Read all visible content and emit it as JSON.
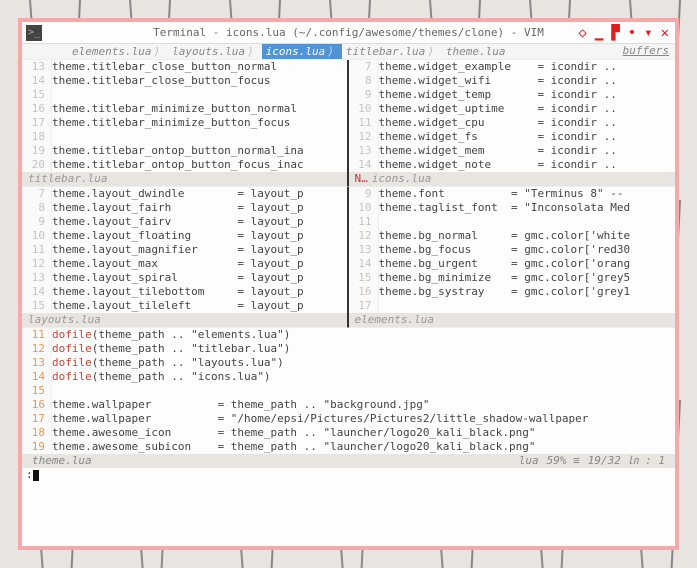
{
  "window": {
    "title": "Terminal - icons.lua (~/.config/awesome/themes/clone) - VIM"
  },
  "tabs": {
    "items": [
      {
        "label": "elements.lua",
        "active": false
      },
      {
        "label": "layouts.lua",
        "active": false
      },
      {
        "label": "icons.lua",
        "active": true
      },
      {
        "label": "titlebar.lua",
        "active": false
      },
      {
        "label": "theme.lua",
        "active": false
      }
    ],
    "right_label": "buffers"
  },
  "pane_top_left": {
    "status": "titlebar.lua",
    "lines": [
      {
        "n": 13,
        "text": "theme.titlebar_close_button_normal      "
      },
      {
        "n": 14,
        "text": "theme.titlebar_close_button_focus       "
      },
      {
        "n": 15,
        "text": ""
      },
      {
        "n": 16,
        "text": "theme.titlebar_minimize_button_normal   "
      },
      {
        "n": 17,
        "text": "theme.titlebar_minimize_button_focus    "
      },
      {
        "n": 18,
        "text": ""
      },
      {
        "n": 19,
        "text": "theme.titlebar_ontop_button_normal_ina  "
      },
      {
        "n": 20,
        "text": "theme.titlebar_ontop_button_focus_inac "
      }
    ]
  },
  "pane_top_right": {
    "status": "icons.lua",
    "status_mark": "N…",
    "lines": [
      {
        "n": 7,
        "text": "theme.widget_example    = icondir .."
      },
      {
        "n": 8,
        "text": "theme.widget_wifi       = icondir .."
      },
      {
        "n": 9,
        "text": "theme.widget_temp       = icondir .."
      },
      {
        "n": 10,
        "text": "theme.widget_uptime     = icondir .."
      },
      {
        "n": 11,
        "text": "theme.widget_cpu        = icondir .."
      },
      {
        "n": 12,
        "text": "theme.widget_fs         = icondir .."
      },
      {
        "n": 13,
        "text": "theme.widget_mem        = icondir .."
      },
      {
        "n": 14,
        "text": "theme.widget_note       = icondir .."
      }
    ]
  },
  "pane_mid_left": {
    "status": "layouts.lua",
    "lines": [
      {
        "n": 7,
        "text": "theme.layout_dwindle        = layout_p"
      },
      {
        "n": 8,
        "text": "theme.layout_fairh          = layout_p"
      },
      {
        "n": 9,
        "text": "theme.layout_fairv          = layout_p"
      },
      {
        "n": 10,
        "text": "theme.layout_floating       = layout_p"
      },
      {
        "n": 11,
        "text": "theme.layout_magnifier      = layout_p"
      },
      {
        "n": 12,
        "text": "theme.layout_max            = layout_p"
      },
      {
        "n": 13,
        "text": "theme.layout_spiral         = layout_p"
      },
      {
        "n": 14,
        "text": "theme.layout_tilebottom     = layout_p"
      },
      {
        "n": 15,
        "text": "theme.layout_tileleft       = layout_p"
      }
    ]
  },
  "pane_mid_right": {
    "status": "elements.lua",
    "lines": [
      {
        "n": 9,
        "text": "theme.font          = \"Terminus 8\" --"
      },
      {
        "n": 10,
        "text": "theme.taglist_font  = \"Inconsolata Med"
      },
      {
        "n": 11,
        "text": ""
      },
      {
        "n": 12,
        "text": "theme.bg_normal     = gmc.color['white"
      },
      {
        "n": 13,
        "text": "theme.bg_focus      = gmc.color['red30"
      },
      {
        "n": 14,
        "text": "theme.bg_urgent     = gmc.color['orang"
      },
      {
        "n": 15,
        "text": "theme.bg_minimize   = gmc.color['grey5"
      },
      {
        "n": 16,
        "text": "theme.bg_systray    = gmc.color['grey1"
      },
      {
        "n": 17,
        "text": ""
      }
    ]
  },
  "pane_bottom": {
    "lines": [
      {
        "n": 11,
        "kw": "dofile",
        "rest": "(theme_path .. \"elements.lua\")"
      },
      {
        "n": 12,
        "kw": "dofile",
        "rest": "(theme_path .. \"titlebar.lua\")"
      },
      {
        "n": 13,
        "kw": "dofile",
        "rest": "(theme_path .. \"layouts.lua\")"
      },
      {
        "n": 14,
        "kw": "dofile",
        "rest": "(theme_path .. \"icons.lua\")"
      },
      {
        "n": 15,
        "text": ""
      },
      {
        "n": 16,
        "text": "theme.wallpaper          = theme_path .. \"background.jpg\""
      },
      {
        "n": 17,
        "text": "theme.wallpaper          = \"/home/epsi/Pictures/Pictures2/little_shadow-wallpaper"
      },
      {
        "n": 18,
        "text": "theme.awesome_icon       = theme_path .. \"launcher/logo20_kali_black.png\""
      },
      {
        "n": 19,
        "text": "theme.awesome_subicon    = theme_path .. \"launcher/logo20_kali_black.png\""
      }
    ]
  },
  "statusbar": {
    "filename": "theme.lua",
    "filetype": "lua",
    "percent": "59% ≡",
    "position": "19/32 ㏑ :   1"
  },
  "cmdline": {
    "prompt": ":"
  }
}
